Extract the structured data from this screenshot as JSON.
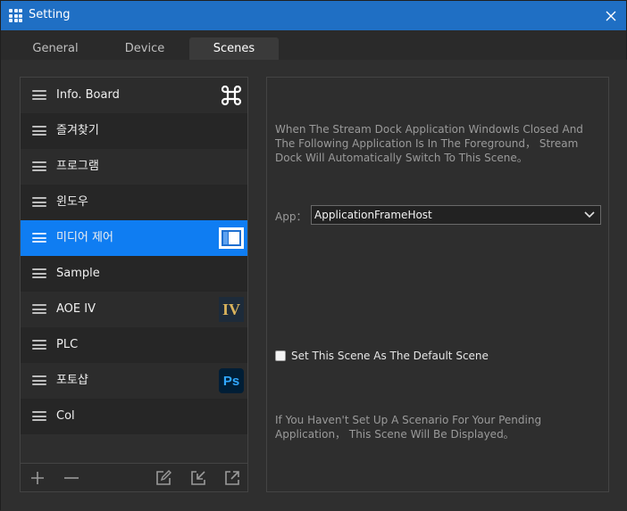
{
  "window": {
    "title": "Setting",
    "accent_color": "#1f6fc4",
    "icons": {
      "app": "grid-app-icon",
      "close": "close-icon"
    }
  },
  "tabs": [
    {
      "label": "General",
      "active": false
    },
    {
      "label": "Device",
      "active": false
    },
    {
      "label": "Scenes",
      "active": true
    }
  ],
  "scenes": {
    "selected_color": "#0f7df2",
    "items": [
      {
        "label": "Info. Board",
        "thumb": "command-key-icon"
      },
      {
        "label": "즐겨찾기",
        "thumb": ""
      },
      {
        "label": "프로그램",
        "thumb": ""
      },
      {
        "label": "윈도우",
        "thumb": ""
      },
      {
        "label": "미디어 제어",
        "thumb": "window-app-icon",
        "selected": true
      },
      {
        "label": "Sample",
        "thumb": ""
      },
      {
        "label": "AOE IV",
        "thumb": "aoe-iv-logo",
        "thumb_text": "IV"
      },
      {
        "label": "PLC",
        "thumb": ""
      },
      {
        "label": "포토샵",
        "thumb": "photoshop-logo",
        "thumb_text": "Ps"
      },
      {
        "label": "Col",
        "thumb": ""
      }
    ],
    "footer_icons": [
      "plus-icon",
      "minus-icon",
      "edit-icon",
      "import-icon",
      "export-icon"
    ]
  },
  "detail": {
    "description": "When The Stream Dock Application WindowIs Closed And The Following Application Is In The Foreground， Stream Dock Will Automatically Switch To This Scene。",
    "app_label": "App：",
    "app_value": "ApplicationFrameHost",
    "default_checkbox_label": "Set This Scene As The Default Scene",
    "default_checked": false,
    "pending_note": "If You Haven't Set Up A Scenario For Your Pending Application， This Scene Will Be Displayed。"
  }
}
